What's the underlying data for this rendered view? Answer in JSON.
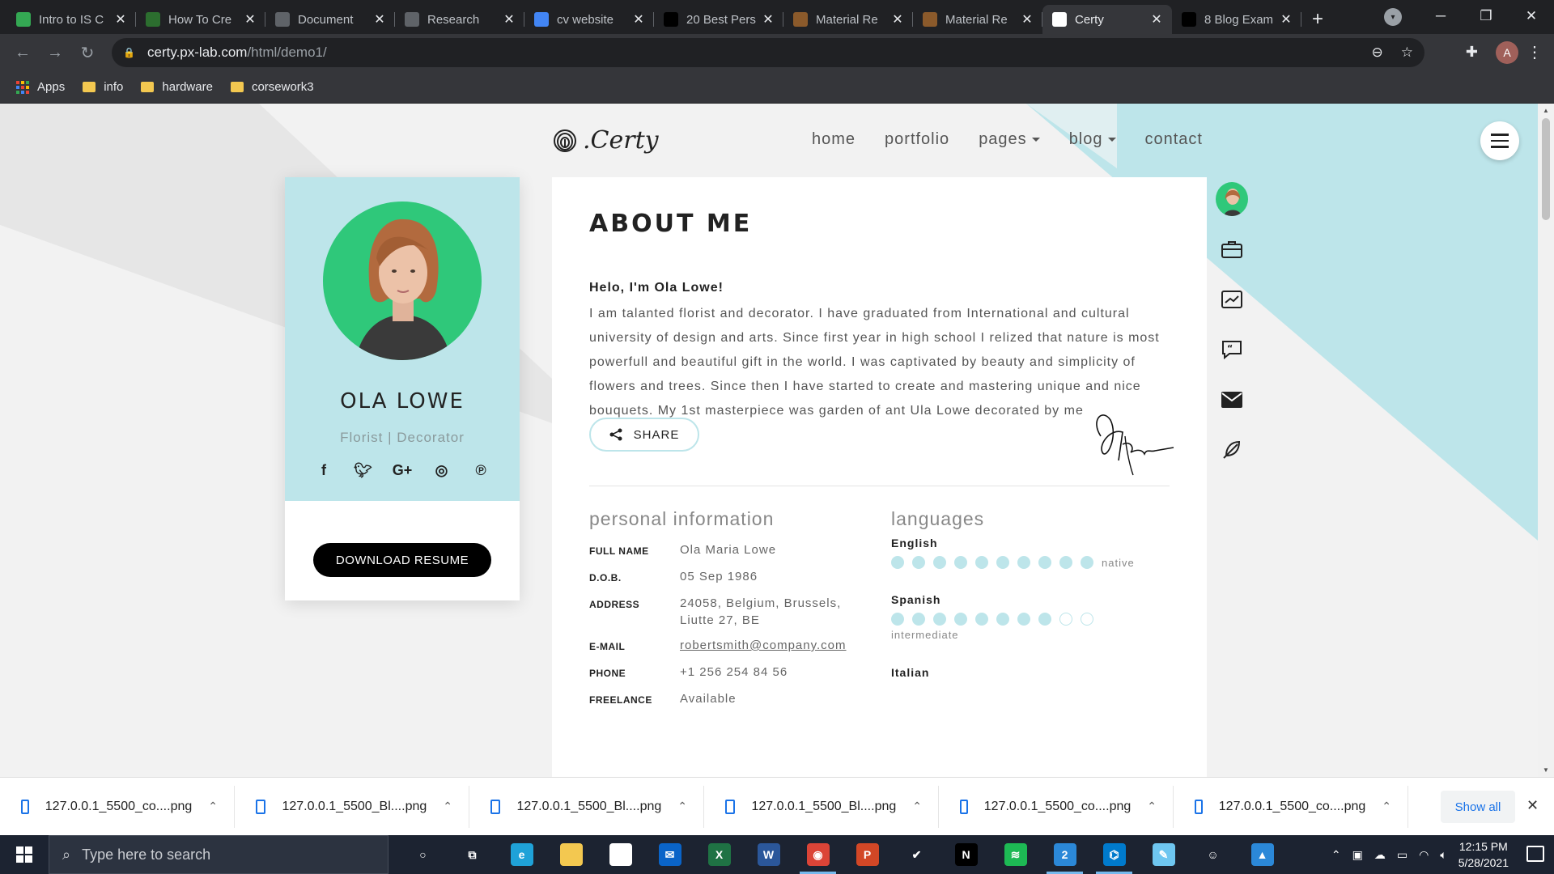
{
  "browser": {
    "tabs": [
      {
        "title": "Intro to IS C",
        "favicon": "drive-icon",
        "color": "#34a853"
      },
      {
        "title": "How To Cre",
        "favicon": "wikihow-icon",
        "color": "#2c6e2f"
      },
      {
        "title": "Document",
        "favicon": "globe-icon",
        "color": "#5f6368"
      },
      {
        "title": "Research",
        "favicon": "globe-icon",
        "color": "#5f6368"
      },
      {
        "title": "cv website",
        "favicon": "google-icon",
        "color": "#4285f4"
      },
      {
        "title": "20 Best Pers",
        "favicon": "d-icon",
        "color": "#000000"
      },
      {
        "title": "Material Re",
        "favicon": "bookmark-b-icon",
        "color": "#8b5a2b"
      },
      {
        "title": "Material Re",
        "favicon": "bookmark-b-icon",
        "color": "#8b5a2b"
      },
      {
        "title": "Certy",
        "favicon": "fingerprint-icon",
        "color": "#ffffff"
      },
      {
        "title": "8 Blog Exam",
        "favicon": "wix-icon",
        "color": "#000000"
      }
    ],
    "active_tab": 8,
    "url_host": "certy.px-lab.com",
    "url_path": "/html/demo1/",
    "profile_initial": "A",
    "bookmarks": [
      {
        "label": "Apps",
        "icon": "apps-grid-icon"
      },
      {
        "label": "info",
        "icon": "folder-icon"
      },
      {
        "label": "hardware",
        "icon": "folder-icon"
      },
      {
        "label": "corsework3",
        "icon": "folder-icon"
      }
    ]
  },
  "site": {
    "logo_text": ".Certy",
    "nav": [
      {
        "label": "home",
        "dropdown": false
      },
      {
        "label": "portfolio",
        "dropdown": false
      },
      {
        "label": "pages",
        "dropdown": true
      },
      {
        "label": "blog",
        "dropdown": true
      },
      {
        "label": "contact",
        "dropdown": false
      }
    ],
    "accent": "#bde5ea",
    "profile": {
      "name": "OLA LOWE",
      "role": "Florist | Decorator",
      "social": [
        "f",
        "twitter",
        "G+",
        "instagram",
        "pinterest"
      ],
      "download_label": "DOWNLOAD RESUME"
    },
    "about": {
      "title": "ABOUT ME",
      "greeting": "Helo, I'm Ola Lowe!",
      "bio": "I am talanted florist and decorator. I have graduated from International and cultural university of design and arts. Since first year in high school I relized that nature is most powerfull and beautiful gift in the world. I was captivated by beauty and simplicity of flowers and trees. Since then I have started to create and mastering unique and nice bouquets. My 1st masterpiece was garden of ant Ula Lowe decorated by me",
      "share_label": "SHARE"
    },
    "personal": {
      "title": "personal information",
      "rows": [
        {
          "k": "FULL NAME",
          "v": "Ola Maria Lowe"
        },
        {
          "k": "D.O.B.",
          "v": "05 Sep 1986"
        },
        {
          "k": "ADDRESS",
          "v": "24058, Belgium, Brussels, Liutte 27, BE"
        },
        {
          "k": "E-MAIL",
          "v": "robertsmith@company.com"
        },
        {
          "k": "PHONE",
          "v": "+1 256 254 84 56"
        },
        {
          "k": "FREELANCE",
          "v": "Available"
        }
      ]
    },
    "languages": {
      "title": "languages",
      "items": [
        {
          "name": "English",
          "level": 10,
          "max": 10,
          "label": "native"
        },
        {
          "name": "Spanish",
          "level": 8,
          "max": 10,
          "label": "intermediate"
        },
        {
          "name": "Italian",
          "level": 0,
          "max": 10,
          "label": ""
        }
      ]
    }
  },
  "downloads": {
    "items": [
      "127.0.0.1_5500_co....png",
      "127.0.0.1_5500_Bl....png",
      "127.0.0.1_5500_Bl....png",
      "127.0.0.1_5500_Bl....png",
      "127.0.0.1_5500_co....png",
      "127.0.0.1_5500_co....png"
    ],
    "show_all": "Show all"
  },
  "taskbar": {
    "search_placeholder": "Type here to search",
    "time": "12:15 PM",
    "date": "5/28/2021",
    "apps": [
      {
        "name": "cortana-icon",
        "color": "transparent",
        "glyph": "○"
      },
      {
        "name": "task-view-icon",
        "color": "transparent",
        "glyph": "⧉"
      },
      {
        "name": "edge-icon",
        "color": "#1fa2d8",
        "glyph": "e"
      },
      {
        "name": "file-explorer-icon",
        "color": "#f3c850",
        "glyph": ""
      },
      {
        "name": "store-icon",
        "color": "#ffffff",
        "glyph": "🛍"
      },
      {
        "name": "mail-icon",
        "color": "#0a64c8",
        "glyph": "✉"
      },
      {
        "name": "excel-icon",
        "color": "#1f7244",
        "glyph": "X"
      },
      {
        "name": "word-icon",
        "color": "#2b579a",
        "glyph": "W"
      },
      {
        "name": "chrome-icon",
        "color": "#db4437",
        "glyph": "◉"
      },
      {
        "name": "powerpoint-icon",
        "color": "#d24726",
        "glyph": "P"
      },
      {
        "name": "todo-icon",
        "color": "transparent",
        "glyph": "✔"
      },
      {
        "name": "netflix-icon",
        "color": "#000000",
        "glyph": "N"
      },
      {
        "name": "spotify-icon",
        "color": "#1db954",
        "glyph": "≋"
      },
      {
        "name": "files-icon",
        "color": "#2b88d8",
        "glyph": "2"
      },
      {
        "name": "vscode-icon",
        "color": "#007acc",
        "glyph": "⌬"
      },
      {
        "name": "notepad-icon",
        "color": "#6ec6f0",
        "glyph": "✎"
      },
      {
        "name": "emoji-icon",
        "color": "transparent",
        "glyph": "☺"
      },
      {
        "name": "photos-icon",
        "color": "#2b88d8",
        "glyph": "▲"
      }
    ]
  }
}
